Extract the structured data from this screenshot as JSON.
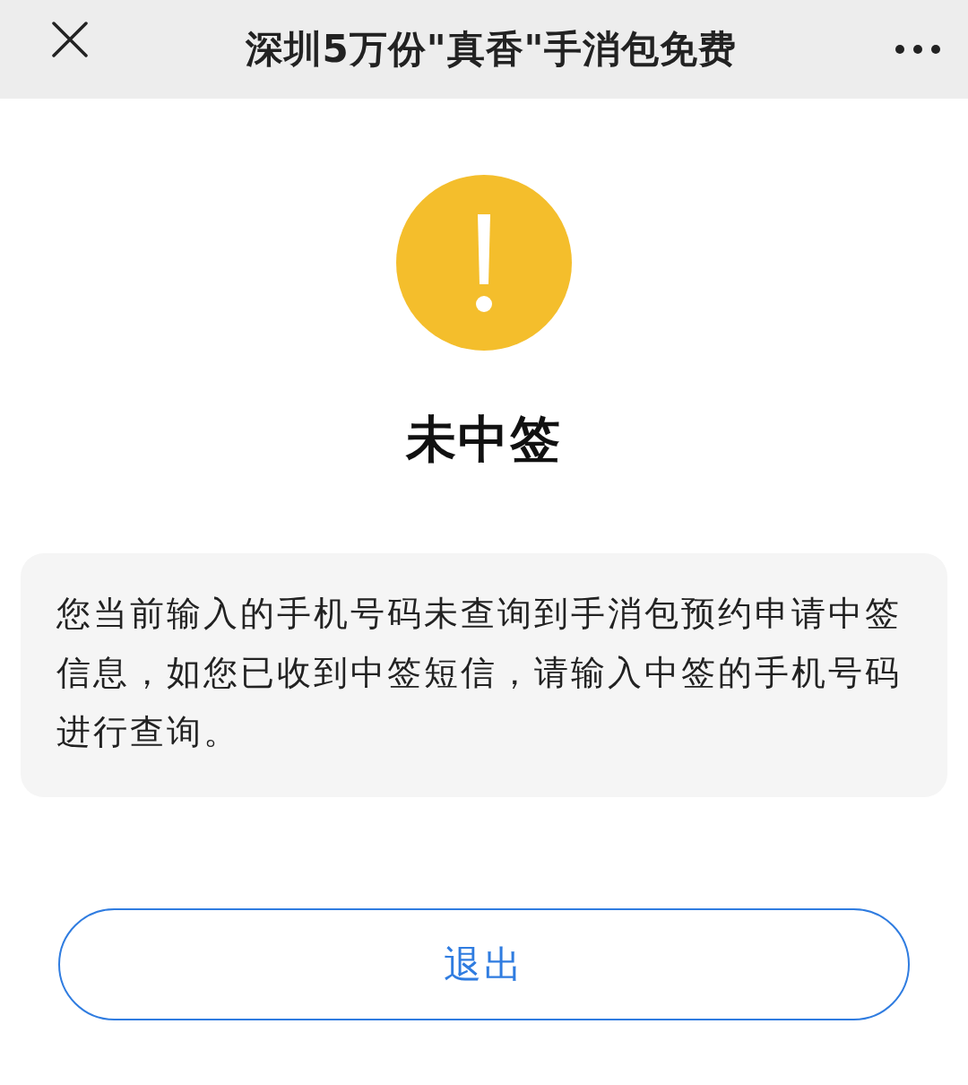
{
  "header": {
    "title": "深圳5万份\"真香\"手消包免费"
  },
  "result": {
    "title": "未中签"
  },
  "message": "您当前输入的手机号码未查询到手消包预约申请中签信息，如您已收到中签短信，请输入中签的手机号码进行查询。",
  "button": {
    "label": "退出"
  }
}
